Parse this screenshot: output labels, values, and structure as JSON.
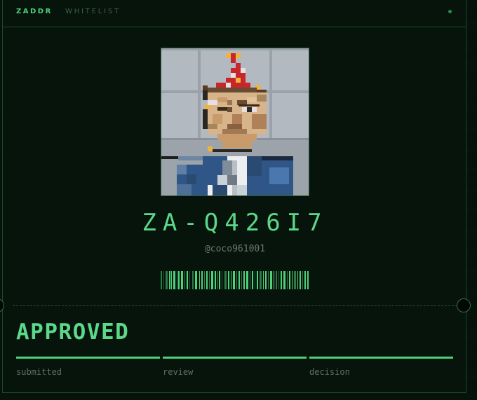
{
  "header": {
    "brand": "ZADDR",
    "tab": "WHITELIST"
  },
  "profile": {
    "ticket_id": "ZA-Q426I7",
    "handle": "@coco961001",
    "avatar_icon": "pixel-art-portrait"
  },
  "status": {
    "decision": "APPROVED",
    "steps": [
      {
        "label": "submitted",
        "complete": true
      },
      {
        "label": "review",
        "complete": true
      },
      {
        "label": "decision",
        "complete": true
      }
    ]
  },
  "colors": {
    "accent": "#4ed07a",
    "background": "#041008",
    "border": "#1b4a2b"
  }
}
